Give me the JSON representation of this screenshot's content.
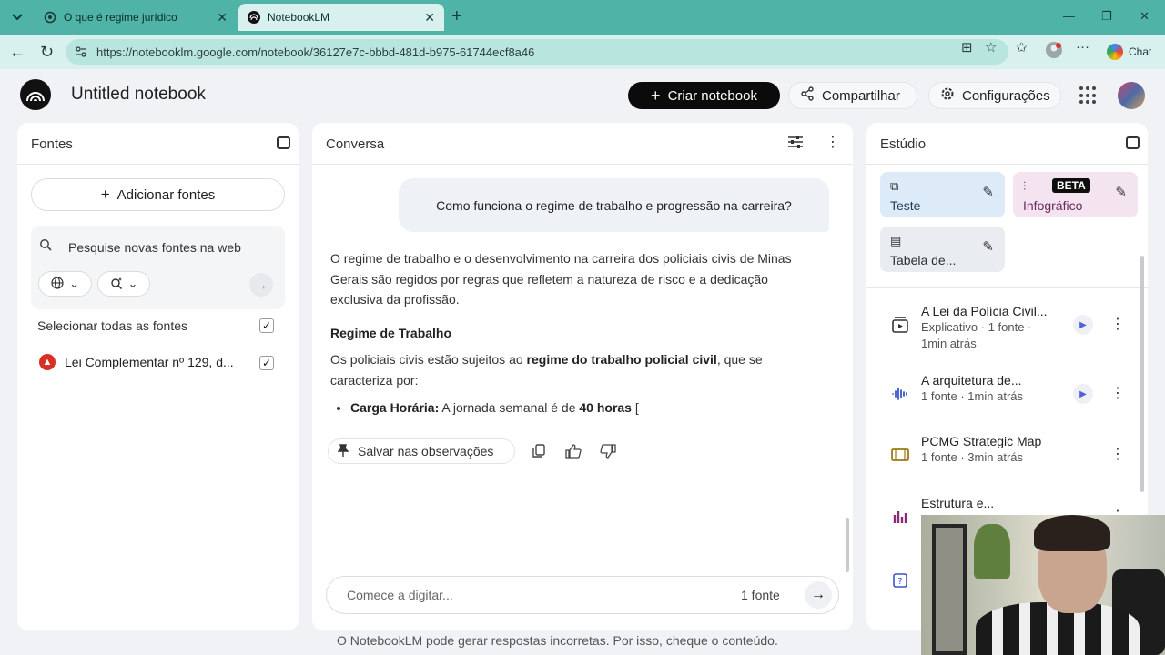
{
  "browser": {
    "tabs": [
      {
        "title": "O que é regime jurídico"
      },
      {
        "title": "NotebookLM"
      }
    ],
    "url": "https://notebooklm.google.com/notebook/36127e7c-bbbd-481d-b975-61744ecf8a46",
    "chat_label": "Chat"
  },
  "header": {
    "title": "Untitled notebook",
    "create_label": "Criar notebook",
    "share_label": "Compartilhar",
    "settings_label": "Configurações"
  },
  "sources": {
    "title": "Fontes",
    "add_label": "Adicionar fontes",
    "search_placeholder": "Pesquise novas fontes na web",
    "select_all": "Selecionar todas as fontes",
    "items": [
      {
        "name": "Lei Complementar nº 129, d..."
      }
    ]
  },
  "chat": {
    "title": "Conversa",
    "question": "Como funciona o regime de trabalho e progressão na carreira?",
    "intro": "O regime de trabalho e o desenvolvimento na carreira dos policiais civis de Minas Gerais são regidos por regras que refletem a natureza de risco e a dedicação exclusiva da profissão.",
    "section_heading": "Regime de Trabalho",
    "section_text_pre": "Os policiais civis estão sujeitos ao ",
    "section_text_bold": "regime do trabalho policial civil",
    "section_text_post": ", que se caracteriza por:",
    "bullet_label": "Carga Horária:",
    "bullet_text_pre": " A jornada semanal é de ",
    "bullet_text_bold": "40 horas",
    "bullet_text_post": " [",
    "save_note_label": "Salvar nas observações",
    "input_placeholder": "Comece a digitar...",
    "source_count": "1 fonte",
    "disclaimer": "O NotebookLM pode gerar respostas incorretas. Por isso, cheque o conteúdo."
  },
  "studio": {
    "title": "Estúdio",
    "tiles": [
      {
        "label": "Teste"
      },
      {
        "label": "Infográfico",
        "badge": "BETA"
      },
      {
        "label": "Tabela de..."
      }
    ],
    "items": [
      {
        "title": "A Lei da Polícia Civil...",
        "meta1": "Explicativo · 1 fonte ·",
        "meta2": "1min atrás",
        "icon": "video-overview-icon",
        "color": "#2a6a2a"
      },
      {
        "title": "A arquitetura de...",
        "meta1": "1 fonte · 1min atrás",
        "icon": "audio-overview-icon",
        "color": "#3a55c8"
      },
      {
        "title": "PCMG Strategic Map",
        "meta1": "1 fonte · 3min atrás",
        "icon": "mind-map-icon",
        "color": "#9a7a12"
      },
      {
        "title": "Estrutura e...",
        "meta1": "",
        "icon": "infographic-icon",
        "color": "#8a2a7a"
      }
    ]
  }
}
